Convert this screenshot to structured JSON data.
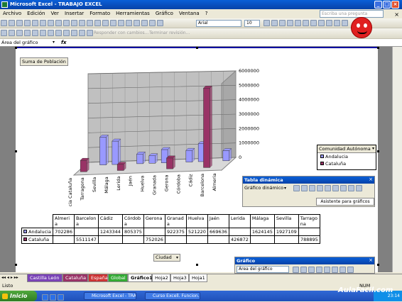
{
  "window": {
    "title": "Microsoft Excel - TRABAJO EXCEL"
  },
  "menu": [
    "Archivo",
    "Edición",
    "Ver",
    "Insertar",
    "Formato",
    "Herramientas",
    "Gráfico",
    "Ventana",
    "?"
  ],
  "help_placeholder": "Escriba una pregunta",
  "font": {
    "name": "Arial",
    "size": "10"
  },
  "review_toolbar": {
    "respond": "Responder con cambios...",
    "finish": "Terminar revisión..."
  },
  "namebox": "Área del gráfico",
  "fx": "fx",
  "chart": {
    "field_button": "Suma de Población",
    "city_button": "Ciudad",
    "legend_title": "Comunidad Autónoma",
    "colors": {
      "andalucia": "#9999ff",
      "cataluna": "#993366",
      "walls": "#c0c0c0"
    }
  },
  "chart_data": {
    "type": "bar",
    "categories": [
      "Almeria",
      "Barcelona",
      "Cádiz",
      "Córdoba",
      "Gerona",
      "Granada",
      "Huelva",
      "Jaén",
      "Lerida",
      "Málaga",
      "Sevilla",
      "Tarragona"
    ],
    "axis_labels": [
      "Andalucia Cataluña",
      "Tarragona",
      "Sevilla",
      "Málaga",
      "Lerida",
      "Jaén",
      "Huelva",
      "Granada",
      "Gerona",
      "Córdoba",
      "Cádiz",
      "Barcelona",
      "Almeria"
    ],
    "series": [
      {
        "name": "Andalucia",
        "values": [
          702286,
          null,
          1243344,
          805375,
          null,
          922375,
          521220,
          669636,
          null,
          1624145,
          1927109,
          null
        ]
      },
      {
        "name": "Cataluña",
        "values": [
          null,
          5511147,
          null,
          null,
          752026,
          null,
          null,
          null,
          426872,
          null,
          null,
          788895
        ]
      }
    ],
    "yticks": [
      "0",
      "1000000",
      "2000000",
      "3000000",
      "4000000",
      "5000000",
      "6000000"
    ],
    "ylim": [
      0,
      6000000
    ]
  },
  "pivot_table": {
    "headers": [
      "Almeria",
      "Barcelona",
      "Cádiz",
      "Córdoba",
      "Gerona",
      "Granada",
      "Huelva",
      "Jaén",
      "Lerida",
      "Málaga",
      "Sevilla",
      "Tarragona"
    ],
    "rows": [
      {
        "label": "Andalucia",
        "cells": [
          "702286",
          "",
          "1243344",
          "805375",
          "",
          "922375",
          "521220",
          "669636",
          "",
          "1624145",
          "1927109",
          ""
        ]
      },
      {
        "label": "Cataluña",
        "cells": [
          "",
          "5511147",
          "",
          "",
          "752026",
          "",
          "",
          "",
          "426872",
          "",
          "",
          "788895"
        ]
      }
    ]
  },
  "pivot_toolbar": {
    "title": "Tabla dinámica",
    "menu": "Gráfico dinámico",
    "wizard": "Asistente para gráficos"
  },
  "chart_toolbar": {
    "title": "Gráfico",
    "select": "Área del gráfico"
  },
  "sheet_tabs": [
    {
      "label": "Castilla León",
      "color": "#7a43b6"
    },
    {
      "label": "Cataluña",
      "color": "#993366"
    },
    {
      "label": "España",
      "color": "#cc3333"
    },
    {
      "label": "Global",
      "color": "#33aa33"
    },
    {
      "label": "Gráfico1",
      "color": "#ffffff"
    },
    {
      "label": "Hoja2",
      "color": "#ffffff"
    },
    {
      "label": "Hoja3",
      "color": "#ffffff"
    },
    {
      "label": "Hoja1",
      "color": "#ffffff"
    }
  ],
  "status": {
    "left": "Listo",
    "num": "NUM"
  },
  "taskbar": {
    "start": "Inicio",
    "tasks": [
      "Microsoft Excel - TRA...",
      "Curso Excell. Funcion..."
    ],
    "clock": "23:14",
    "watermark": "AulaFacil.com"
  }
}
